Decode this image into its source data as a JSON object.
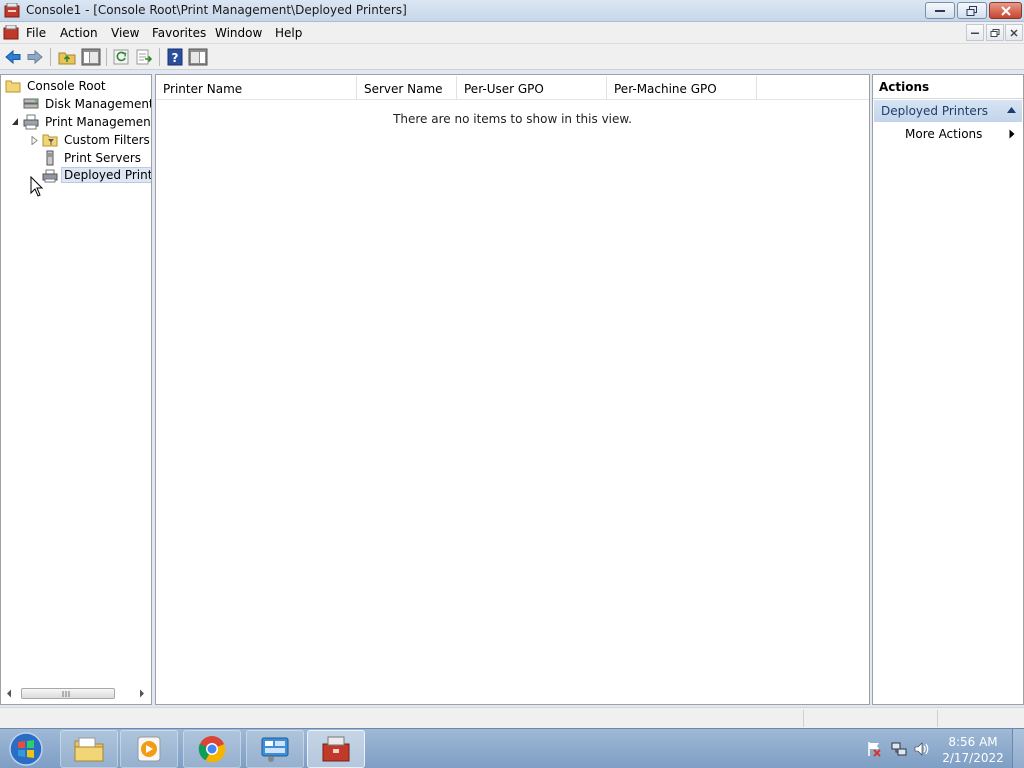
{
  "window": {
    "title": "Console1 - [Console Root\\Print Management\\Deployed Printers]"
  },
  "menu": {
    "items": [
      "File",
      "Action",
      "View",
      "Favorites",
      "Window",
      "Help"
    ]
  },
  "tree": {
    "items": [
      {
        "label": "Console Root",
        "icon": "folder-icon"
      },
      {
        "label": "Disk Management(L",
        "icon": "disk-icon"
      },
      {
        "label": "Print Management",
        "icon": "printer-management-icon"
      },
      {
        "label": "Custom Filters",
        "icon": "filter-folder-icon"
      },
      {
        "label": "Print Servers",
        "icon": "server-icon"
      },
      {
        "label": "Deployed Printer",
        "icon": "printer-icon"
      }
    ],
    "selected": "Deployed Printer"
  },
  "list": {
    "columns": [
      "Printer Name",
      "Server Name",
      "Per-User GPO",
      "Per-Machine GPO"
    ],
    "empty_message": "There are no items to show in this view."
  },
  "actions": {
    "title": "Actions",
    "group": "Deployed Printers",
    "items": [
      "More Actions"
    ]
  },
  "taskbar": {
    "clock_time": "8:56 AM",
    "clock_date": "2/17/2022"
  },
  "colors": {
    "selection": "#dde6f2",
    "actions_group": "#c3d5ec",
    "taskbar": "#8eacd0"
  }
}
